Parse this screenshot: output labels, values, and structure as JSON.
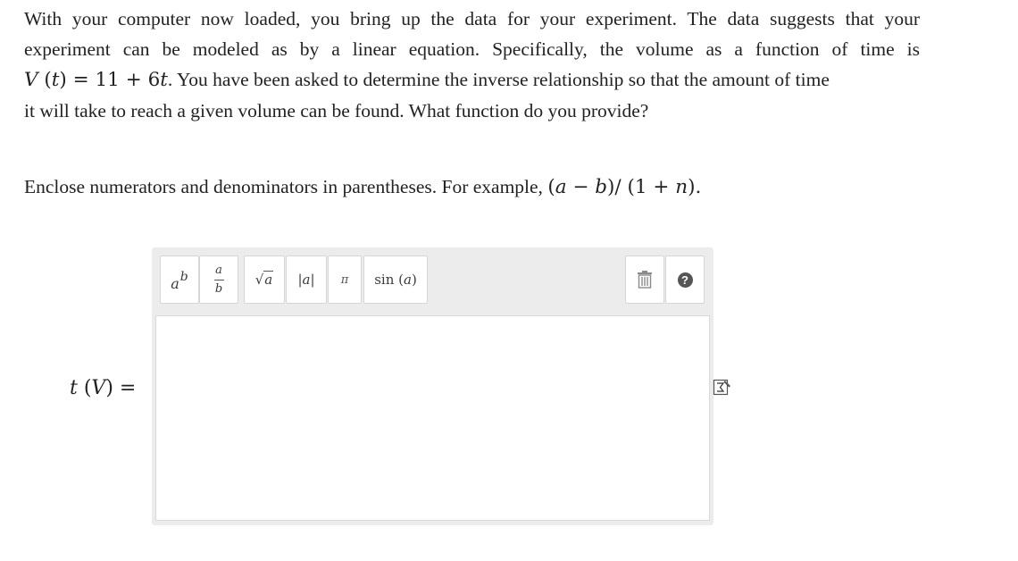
{
  "problem": {
    "line1": "With your computer now loaded, you bring up the data for your experiment. The data suggests that your",
    "line2": "experiment can be modeled as by a linear equation. Specifically, the volume as a function of time is",
    "line3_math": {
      "func": "V",
      "arg": "t",
      "equals": "=",
      "constant": "11",
      "plus": "+",
      "coef": "6",
      "var": "t"
    },
    "line3_text": ". You have been asked to determine the inverse relationship so that the amount of time",
    "line4": "it will take to reach a given volume can be found. What function do you provide?"
  },
  "instructions": {
    "text": "Enclose numerators and denominators in parentheses. For example,",
    "example": {
      "open": "(",
      "a": "a",
      "minus": "−",
      "b": "b",
      "close_slash": ")/",
      "open2": "(",
      "one": "1",
      "plus": "+",
      "n": "n",
      "close2": ")",
      "period": "."
    }
  },
  "answer": {
    "label_func": "t",
    "label_arg": "V",
    "label_equals": "=",
    "value": ""
  },
  "toolbar": {
    "power": {
      "base": "a",
      "exp": "b"
    },
    "fraction": {
      "num": "a",
      "den": "b"
    },
    "sqrt": {
      "symbol": "√",
      "rad": "a"
    },
    "abs": {
      "bar": "|",
      "var": "a"
    },
    "pi": "π",
    "sin": {
      "name": "sin",
      "var": "a"
    },
    "help": "?"
  },
  "icons": {
    "trash": "trash-icon",
    "help": "help-icon",
    "sigma": "sigma-icon"
  },
  "colors": {
    "toolbar_bg": "#ececec",
    "text": "#222222",
    "help_circle": "#555555"
  }
}
